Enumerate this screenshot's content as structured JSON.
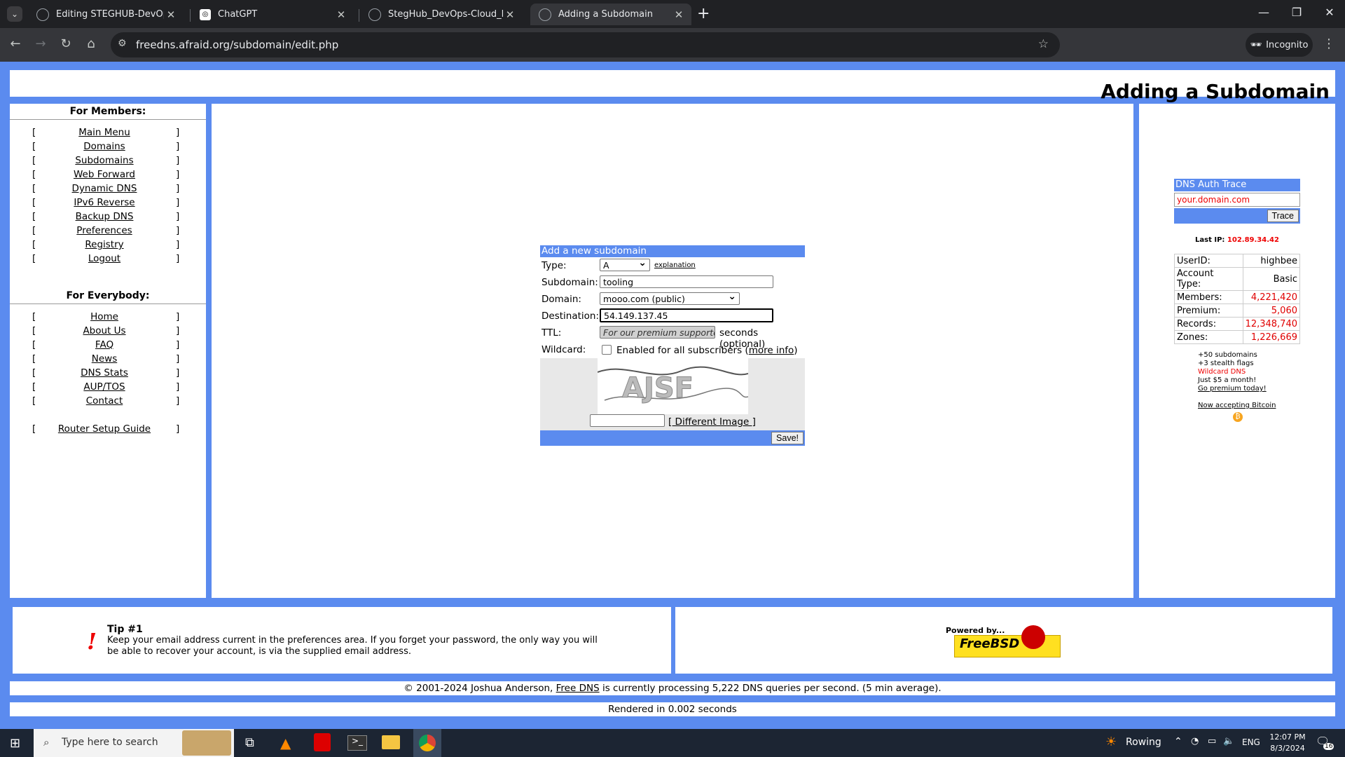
{
  "browser": {
    "tabs": [
      {
        "title": "Editing STEGHUB-DevOps-cloud",
        "active": false
      },
      {
        "title": "ChatGPT",
        "active": false
      },
      {
        "title": "StegHub_DevOps-Cloud_Engine",
        "active": false
      },
      {
        "title": "Adding a Subdomain",
        "active": true
      }
    ],
    "url": "freedns.afraid.org/subdomain/edit.php",
    "incognito_label": "Incognito"
  },
  "page": {
    "title": "Adding a Subdomain",
    "members_heading": "For Members:",
    "members_links": [
      "Main Menu",
      "Domains",
      "Subdomains",
      "Web Forward",
      "Dynamic DNS",
      "IPv6 Reverse",
      "Backup DNS",
      "Preferences",
      "Registry",
      "Logout"
    ],
    "everybody_heading": "For Everybody:",
    "everybody_links": [
      "Home",
      "About Us",
      "FAQ",
      "News",
      "DNS Stats",
      "AUP/TOS",
      "Contact"
    ],
    "router_link": "Router Setup Guide",
    "bracket_open": "[",
    "bracket_close": "]"
  },
  "form": {
    "header": "Add a new subdomain",
    "type_label": "Type:",
    "type_value": "A",
    "explanation_link": "explanation",
    "subdomain_label": "Subdomain:",
    "subdomain_value": "tooling",
    "domain_label": "Domain:",
    "domain_value": "mooo.com (public)",
    "destination_label": "Destination:",
    "destination_value": "54.149.137.45",
    "ttl_label": "TTL:",
    "ttl_placeholder": "For our premium supporters",
    "ttl_suffix": "seconds (optional)",
    "wildcard_label": "Wildcard:",
    "wildcard_text": "Enabled for all subscribers (",
    "wildcard_more": "more info",
    "wildcard_close": ")",
    "captcha_text": "AJSF",
    "different_image": "[ Different Image ]",
    "save_label": "Save!"
  },
  "sidebar_right": {
    "trace_title": "DNS Auth Trace",
    "trace_input": "your.domain.com",
    "trace_button": "Trace",
    "last_ip_label": "Last IP:",
    "last_ip": "102.89.34.42",
    "stats": [
      {
        "label": "UserID:",
        "value": "highbee",
        "color": "#000000"
      },
      {
        "label": "Account Type:",
        "value": "Basic",
        "color": "#000000"
      },
      {
        "label": "Members:",
        "value": "4,221,420",
        "color": "#e00000"
      },
      {
        "label": "Premium:",
        "value": "5,060",
        "color": "#e00000"
      },
      {
        "label": "Records:",
        "value": "12,348,740",
        "color": "#e00000"
      },
      {
        "label": "Zones:",
        "value": "1,226,669",
        "color": "#e00000"
      }
    ],
    "promo_lines": [
      "+50 subdomains",
      "+3 stealth flags",
      "Wildcard DNS",
      "Just $5 a month!"
    ],
    "promo_link": "Go premium today!",
    "bitcoin_link": "Now accepting Bitcoin"
  },
  "footer": {
    "tip_title": "Tip #1",
    "tip_text": "Keep your email address current in the preferences area. If you forget your password, the only way you will be able to recover your account, is via the supplied email address.",
    "powered_by": "Powered by...",
    "freebsd": "FreeBSD",
    "copyright_pre": "© 2001-2024 Joshua Anderson, ",
    "copyright_link": "Free DNS",
    "copyright_post": " is currently processing 5,222 DNS queries per second. (5 min average).",
    "rendered": "Rendered in 0.002 seconds"
  },
  "taskbar": {
    "search_placeholder": "Type here to search",
    "weather": "Rowing",
    "lang": "ENG",
    "time": "12:07 PM",
    "date": "8/3/2024",
    "notification_count": "16"
  }
}
